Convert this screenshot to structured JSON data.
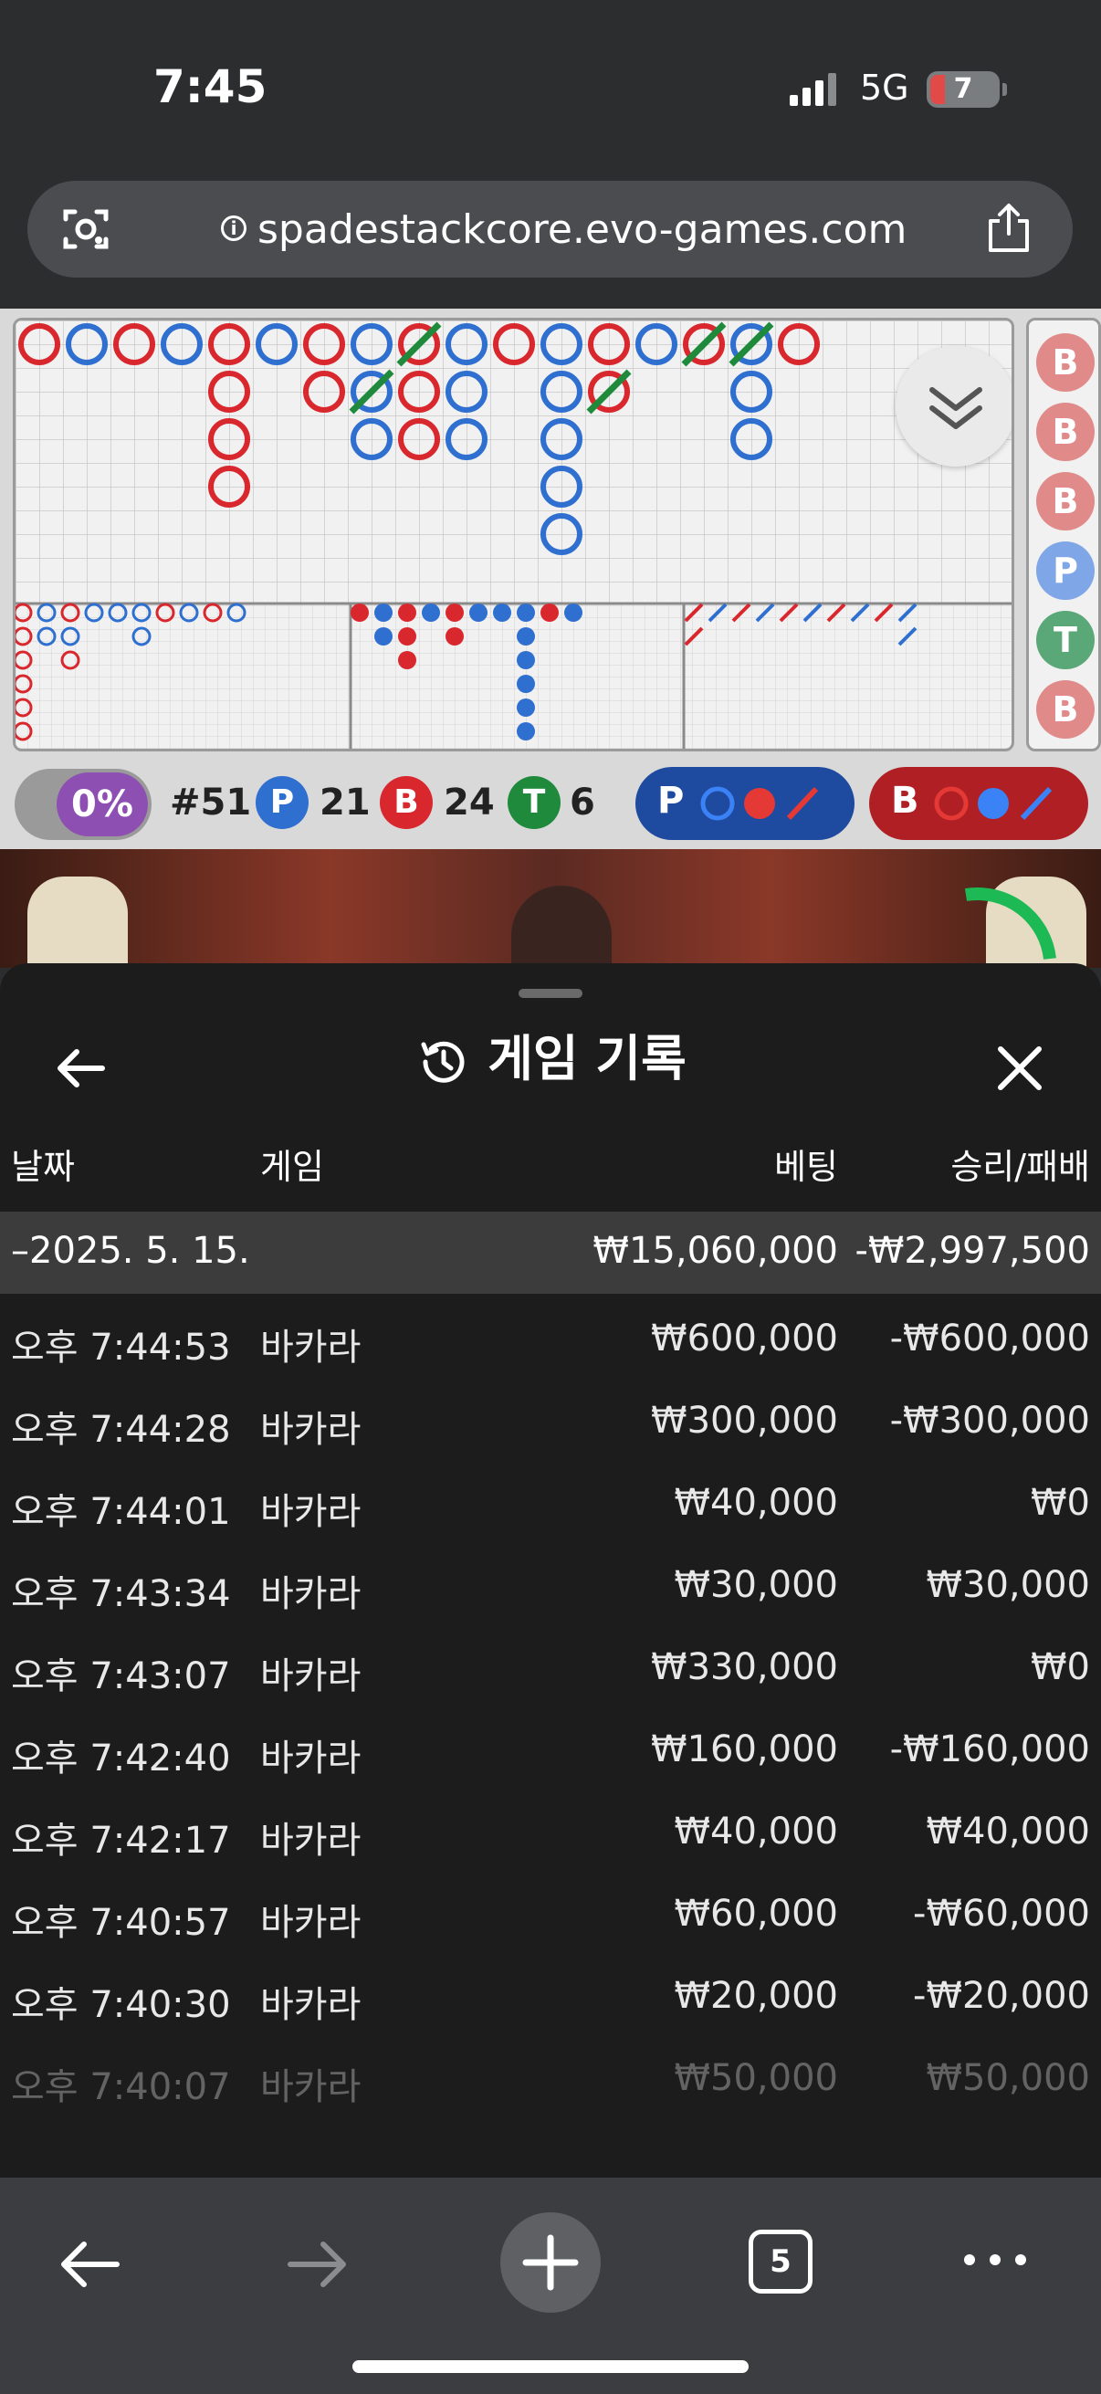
{
  "status_bar": {
    "time": "7:45",
    "network": "5G",
    "battery": "7"
  },
  "browser": {
    "url": "spadestackcore.evo-games.com",
    "icons": [
      "camera-search-icon",
      "info-icon",
      "share-icon"
    ]
  },
  "roadmap": {
    "side_column": [
      "B",
      "B",
      "B",
      "P",
      "T",
      "B"
    ],
    "colors": {
      "banker": "#d9272e",
      "player": "#2f6fd0",
      "tie": "#1f8a3b"
    }
  },
  "stats": {
    "percent": "0%",
    "shoe": "#51",
    "player_label": "P",
    "player_count": "21",
    "banker_label": "B",
    "banker_count": "24",
    "tie_label": "T",
    "tie_count": "6",
    "player_predict_label": "P",
    "banker_predict_label": "B"
  },
  "history": {
    "title": "게임 기록",
    "columns": {
      "date": "날짜",
      "game": "게임",
      "bet": "베팅",
      "win_loss": "승리/패배"
    },
    "day": {
      "date": "–2025. 5. 15.",
      "bet": "₩15,060,000",
      "win_loss": "-₩2,997,500"
    },
    "rows": [
      {
        "time": "오후 7:44:53",
        "game": "바카라",
        "bet": "₩600,000",
        "win_loss": "-₩600,000"
      },
      {
        "time": "오후 7:44:28",
        "game": "바카라",
        "bet": "₩300,000",
        "win_loss": "-₩300,000"
      },
      {
        "time": "오후 7:44:01",
        "game": "바카라",
        "bet": "₩40,000",
        "win_loss": "₩0"
      },
      {
        "time": "오후 7:43:34",
        "game": "바카라",
        "bet": "₩30,000",
        "win_loss": "₩30,000"
      },
      {
        "time": "오후 7:43:07",
        "game": "바카라",
        "bet": "₩330,000",
        "win_loss": "₩0"
      },
      {
        "time": "오후 7:42:40",
        "game": "바카라",
        "bet": "₩160,000",
        "win_loss": "-₩160,000"
      },
      {
        "time": "오후 7:42:17",
        "game": "바카라",
        "bet": "₩40,000",
        "win_loss": "₩40,000"
      },
      {
        "time": "오후 7:40:57",
        "game": "바카라",
        "bet": "₩60,000",
        "win_loss": "-₩60,000"
      },
      {
        "time": "오후 7:40:30",
        "game": "바카라",
        "bet": "₩20,000",
        "win_loss": "-₩20,000"
      },
      {
        "time": "오후 7:40:07",
        "game": "바카라",
        "bet": "₩50,000",
        "win_loss": "₩50,000"
      }
    ]
  },
  "bottom_nav": {
    "tab_count": "5"
  }
}
